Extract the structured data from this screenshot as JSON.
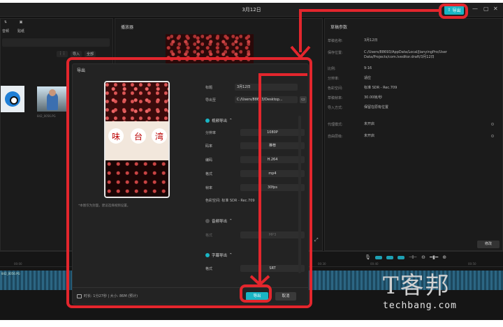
{
  "app": {
    "title": "3月12日",
    "export_label": "导出"
  },
  "media": {
    "tabs": [
      {
        "label": "音频"
      },
      {
        "label": "贴纸"
      }
    ],
    "tools": [
      {
        "label": "⋮⋮"
      },
      {
        "label": "导入"
      },
      {
        "label": "全部"
      }
    ],
    "thumb_label": "842_0056.PG"
  },
  "player": {
    "title": "播放器"
  },
  "props": {
    "title": "草稿参数",
    "rows": [
      {
        "k": "草稿名称:",
        "v": "3月12日"
      },
      {
        "k": "保存位置:",
        "v": "C:/Users/88693/AppData/Local/JianyingPro/User Data/Projects/com.lveditor.draft/3月12日"
      },
      {
        "k": "比例:",
        "v": "9:16"
      },
      {
        "k": "分辨率:",
        "v": "适应"
      },
      {
        "k": "色彩空间:",
        "v": "标准 SDR - Rec.709"
      },
      {
        "k": "草稿帧率:",
        "v": "30.00帧/秒"
      },
      {
        "k": "导入方式:",
        "v": "保留在原有位置"
      },
      {
        "k": "代理模式:",
        "v": "未开启"
      },
      {
        "k": "自由层级:",
        "v": "未开启"
      }
    ],
    "modify_label": "修改"
  },
  "dialog": {
    "title": "导出",
    "cover_chars": [
      "味",
      "台",
      "湾"
    ],
    "cover_hint": "*本图仅为封面，建议选择视频设置。",
    "name_label": "标题",
    "name_value": "3月12日",
    "path_label": "导出至",
    "path_value": "C:/Users/88693/Desktop...",
    "video_section": "视频导出",
    "video_fields": [
      {
        "label": "分辨率",
        "value": "1080P"
      },
      {
        "label": "码率",
        "value": "推荐"
      },
      {
        "label": "编码",
        "value": "H.264"
      },
      {
        "label": "格式",
        "value": "mp4"
      },
      {
        "label": "帧率",
        "value": "30fps"
      }
    ],
    "color_note": "色彩空间:  标准 SDR - Rec.709",
    "audio_section": "音频导出",
    "audio_field": {
      "label": "格式",
      "value": "MP3"
    },
    "subtitle_section": "字幕导出",
    "subtitle_field": {
      "label": "格式",
      "value": "SRT"
    },
    "footer_info": "时长: 1分27秒 | 大小: 86M (预计)",
    "export_label": "导出",
    "cancel_label": "取消"
  },
  "timeline": {
    "ticks": [
      {
        "t": "00:00"
      },
      {
        "t": "00:10"
      },
      {
        "t": "00:20"
      },
      {
        "t": "00:30"
      },
      {
        "t": "00:40"
      },
      {
        "t": "00:50"
      }
    ],
    "track_label": "842_0056.PG"
  },
  "watermark": {
    "cn": "T客邦",
    "en": "techbang.com"
  }
}
